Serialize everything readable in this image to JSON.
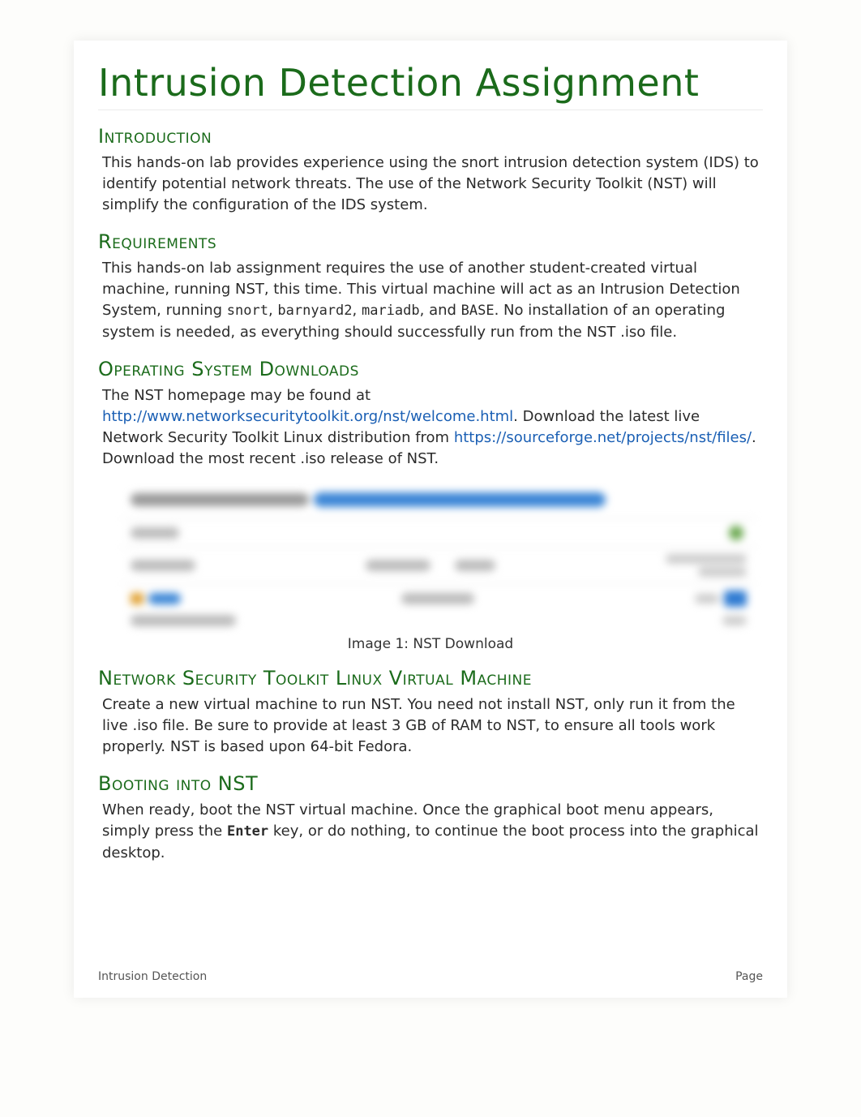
{
  "title": "Intrusion Detection Assignment",
  "sections": {
    "intro": {
      "heading": "Introduction",
      "body": "This hands-on lab provides experience using the snort intrusion detection system (IDS) to identify potential network threats. The use of the Network Security Toolkit (NST) will simplify the configuration of the IDS system."
    },
    "req": {
      "heading": "Requirements",
      "p1_a": "This hands-on lab assignment requires the use of another student-created virtual machine, running NST, this time. This virtual machine will act as an Intrusion Detection System, running ",
      "code1": "snort",
      "sep1": ", ",
      "code2": "barnyard2",
      "sep2": ", ",
      "code3": "mariadb",
      "sep3": ", and ",
      "code4": "BASE",
      "p1_b": ". No installation of an operating system is needed, as everything should successfully run from the NST .iso file."
    },
    "osdl": {
      "heading": "Operating System Downloads",
      "p1_a": "The NST homepage may be found at ",
      "link1": "http://www.networksecuritytoolkit.org/nst/welcome.html",
      "p1_b": ". Download the latest live Network Security Toolkit Linux distribution from ",
      "link2": "https://sourceforge.net/projects/nst/files/",
      "p1_c": ". Download the most recent .iso release of NST."
    },
    "caption1": "Image 1: NST Download",
    "nstvm": {
      "heading": "Network Security Toolkit Linux Virtual Machine",
      "body": "Create a new virtual machine to run NST. You need not install NST, only run it from the live .iso file. Be sure to provide at least 3 GB of RAM to NST, to ensure all tools work properly. NST is based upon 64-bit Fedora."
    },
    "boot": {
      "heading": "Booting into NST",
      "p1_a": "When ready, boot the NST virtual machine. Once the graphical boot menu appears, simply press the ",
      "key": "Enter",
      "p1_b": " key, or do nothing, to continue the boot process into the graphical desktop."
    }
  },
  "footer": {
    "left": "Intrusion Detection",
    "right": "Page"
  }
}
